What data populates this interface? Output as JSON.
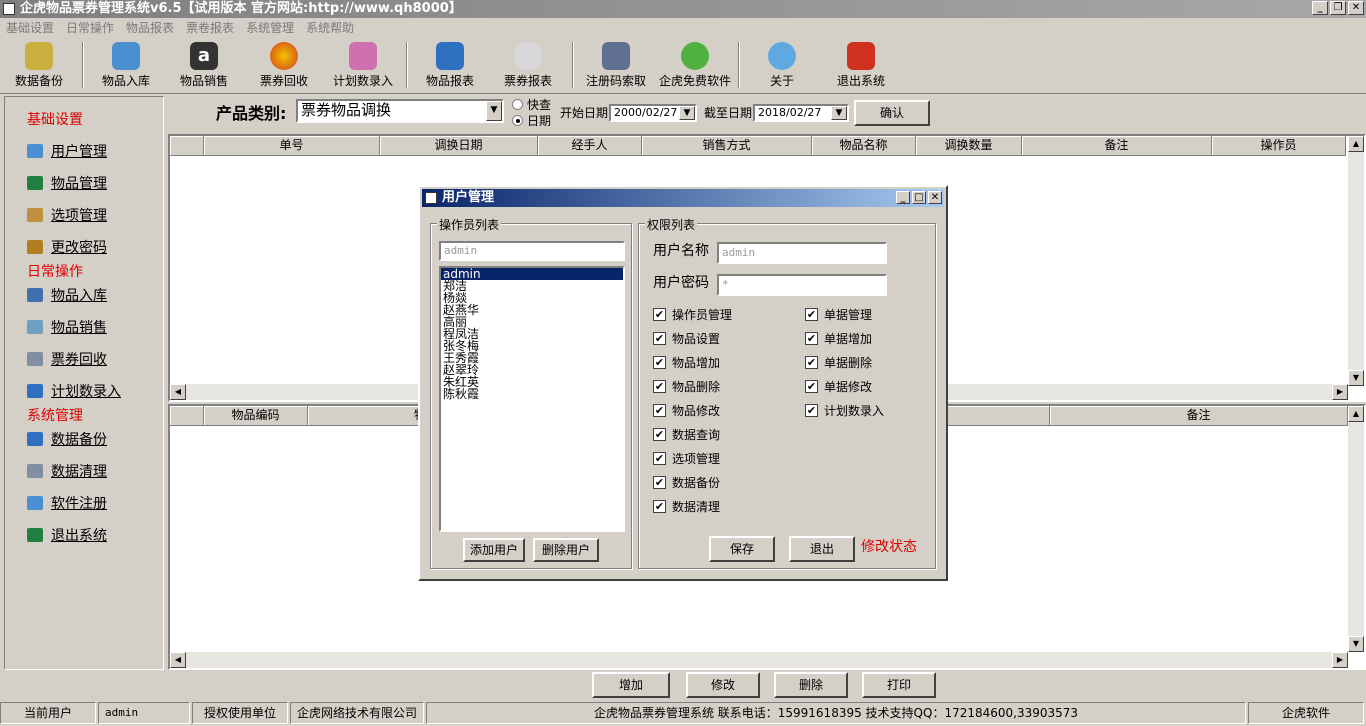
{
  "window": {
    "title": "企虎物品票券管理系统v6.5【试用版本 官方网站:http://www.qh8000】"
  },
  "menu": [
    "基础设置",
    "日常操作",
    "物品报表",
    "票卷报表",
    "系统管理",
    "系统帮助"
  ],
  "toolbar": [
    "数据备份",
    "物品入库",
    "物品销售",
    "票券回收",
    "计划数录入",
    "物品报表",
    "票券报表",
    "注册码索取",
    "企虎免费软件",
    "关于",
    "退出系统"
  ],
  "sidebar": {
    "sections": [
      {
        "title": "基础设置",
        "items": [
          "用户管理",
          "物品管理",
          "选项管理",
          "更改密码"
        ]
      },
      {
        "title": "日常操作",
        "items": [
          "物品入库",
          "物品销售",
          "票券回收",
          "计划数录入"
        ]
      },
      {
        "title": "系统管理",
        "items": [
          "数据备份",
          "数据清理",
          "软件注册",
          "退出系统"
        ]
      }
    ]
  },
  "filter": {
    "label": "产品类别:",
    "category": "票券物品调换",
    "radio_quick": "快查",
    "radio_date": "日期",
    "start_label": "开始日期",
    "start_date": "2000/02/27",
    "end_label": "截至日期",
    "end_date": "2018/02/27",
    "confirm": "确认"
  },
  "grid1": {
    "columns": [
      "",
      "单号",
      "调换日期",
      "经手人",
      "销售方式",
      "物品名称",
      "调换数量",
      "备注",
      "操作员"
    ]
  },
  "grid2": {
    "columns": [
      "",
      "物品编码",
      "物",
      "备注"
    ]
  },
  "actions": {
    "add": "增加",
    "edit": "修改",
    "delete": "删除",
    "print": "打印"
  },
  "status": {
    "cur_user_label": "当前用户",
    "cur_user": "admin",
    "auth_label": "授权使用单位",
    "auth_org": "企虎网络技术有限公司",
    "info": "企虎物品票券管理系统  联系电话：15991618395  技术支持QQ：172184600,33903573",
    "brand": "企虎软件"
  },
  "dialog": {
    "title": "用户管理",
    "operators_group": "操作员列表",
    "search_value": "admin",
    "operators": [
      "admin",
      "郑洁",
      "杨燚",
      "赵燕华",
      "高丽",
      "程凤洁",
      "张冬梅",
      "王秀霞",
      "赵翠玲",
      "朱红英",
      "陈秋霞"
    ],
    "add_user": "添加用户",
    "delete_user": "删除用户",
    "perm_group": "权限列表",
    "username_label": "用户名称",
    "username": "admin",
    "password_label": "用户密码",
    "password": "*",
    "perms_left": [
      "操作员管理",
      "物品设置",
      "物品增加",
      "物品删除",
      "物品修改",
      "数据查询",
      "选项管理",
      "数据备份",
      "数据清理"
    ],
    "perms_right": [
      "单据管理",
      "单据增加",
      "单据删除",
      "单据修改",
      "计划数录入"
    ],
    "check_mark": "✔",
    "save": "保存",
    "exit": "退出",
    "mode": "修改状态"
  }
}
